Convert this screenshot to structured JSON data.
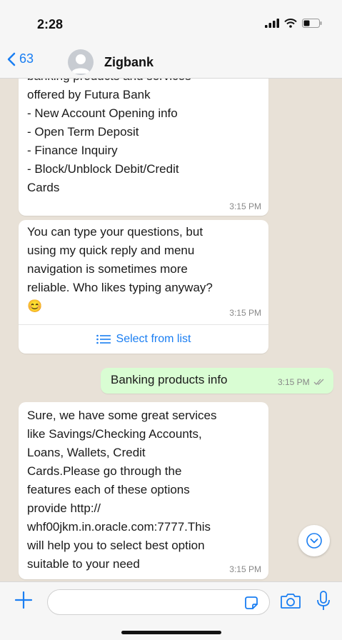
{
  "status_bar": {
    "time": "2:28"
  },
  "header": {
    "back_count": "63",
    "contact_name": "Zigbank"
  },
  "messages": [
    {
      "direction": "incoming",
      "text": "banking products and services\noffered by Futura Bank\n- New Account Opening info\n- Open Term Deposit\n- Finance Inquiry\n- Block/Unblock Debit/Credit\nCards",
      "time": "3:15 PM"
    },
    {
      "direction": "incoming",
      "text": "You can type your questions, but\nusing my quick reply and menu\nnavigation is sometimes more\nreliable.  Who likes typing anyway?\n😊",
      "time": "3:15 PM",
      "button": "Select from list"
    },
    {
      "direction": "outgoing",
      "text": "Banking products info",
      "time": "3:15 PM"
    },
    {
      "direction": "incoming",
      "text": "Sure, we have some great services\nlike Savings/Checking Accounts,\nLoans, Wallets, Credit\nCards.Please go through the\nfeatures each of these options\nprovide http://\nwhf00jkm.in.oracle.com:7777.This\nwill help you to select best option\nsuitable to your need",
      "time": "3:15 PM"
    }
  ],
  "colors": {
    "accent": "#1a7ef2",
    "chat_bg": "#e8e1d7",
    "outgoing_bubble": "#d9fdd3"
  }
}
